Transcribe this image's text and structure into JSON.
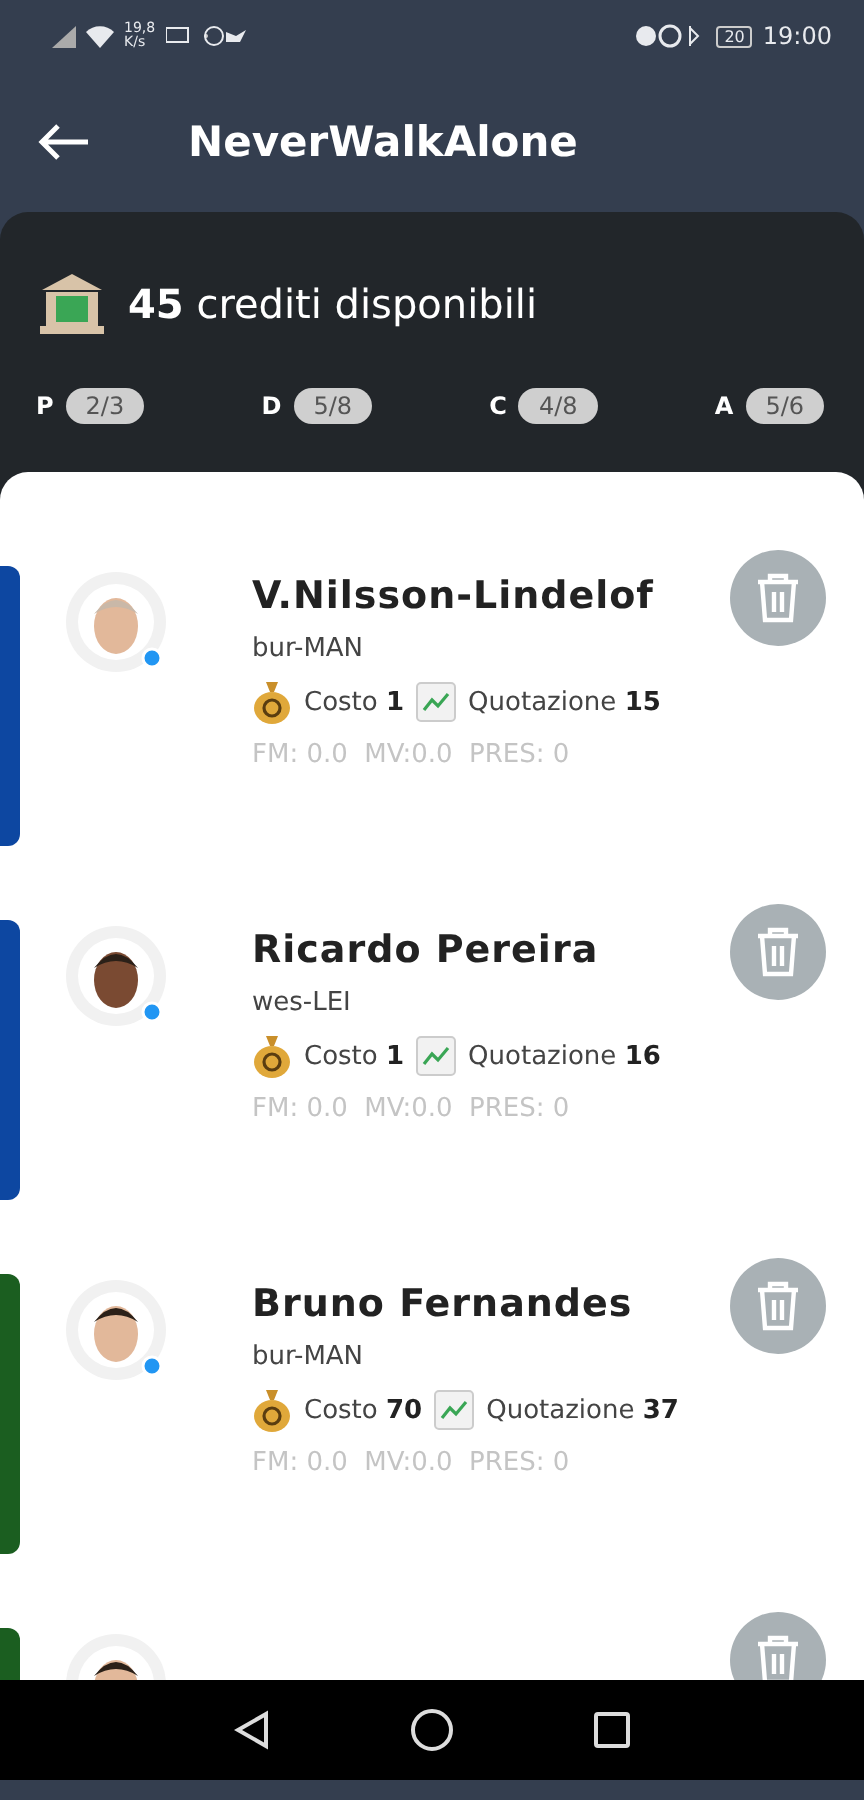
{
  "status_bar": {
    "net_speed": "19,8 K/s",
    "battery": "20",
    "time": "19:00"
  },
  "header": {
    "title": "NeverWalkAlone"
  },
  "credits": {
    "amount": "45",
    "label": "crediti disponibili"
  },
  "roles": [
    {
      "letter": "P",
      "count": "2/3"
    },
    {
      "letter": "D",
      "count": "5/8"
    },
    {
      "letter": "C",
      "count": "4/8"
    },
    {
      "letter": "A",
      "count": "5/6"
    }
  ],
  "players": [
    {
      "name": "V.Nilsson-Lindelof",
      "team": "bur-MAN",
      "cost_label": "Costo",
      "cost": "1",
      "quote_label": "Quotazione",
      "quote": "15",
      "stats": "FM: 0.0  MV:0.0  PRES: 0",
      "color": "#0d47a1"
    },
    {
      "name": "Ricardo Pereira",
      "team": "wes-LEI",
      "cost_label": "Costo",
      "cost": "1",
      "quote_label": "Quotazione",
      "quote": "16",
      "stats": "FM: 0.0  MV:0.0  PRES: 0",
      "color": "#0d47a1"
    },
    {
      "name": "Bruno Fernandes",
      "team": "bur-MAN",
      "cost_label": "Costo",
      "cost": "70",
      "quote_label": "Quotazione",
      "quote": "37",
      "stats": "FM: 0.0  MV:0.0  PRES: 0",
      "color": "#1b5e20"
    },
    {
      "kind": "partial",
      "color": "#1b5e20"
    }
  ]
}
